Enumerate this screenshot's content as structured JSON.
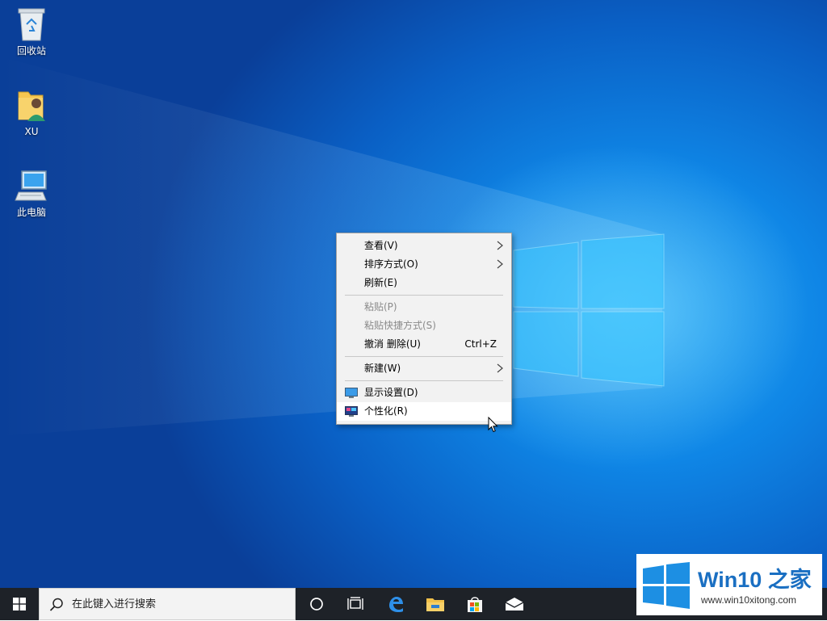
{
  "desktop": {
    "icons": [
      {
        "label": "回收站",
        "icon": "recycle-bin-icon"
      },
      {
        "label": "XU",
        "icon": "user-folder-icon"
      },
      {
        "label": "此电脑",
        "icon": "this-pc-icon"
      }
    ]
  },
  "context_menu": {
    "items": [
      {
        "label": "查看(V)",
        "submenu": true
      },
      {
        "label": "排序方式(O)",
        "submenu": true
      },
      {
        "label": "刷新(E)"
      },
      {
        "label": "粘贴(P)",
        "disabled": true
      },
      {
        "label": "粘贴快捷方式(S)",
        "disabled": true
      },
      {
        "label": "撤消 删除(U)",
        "shortcut": "Ctrl+Z"
      },
      {
        "label": "新建(W)",
        "submenu": true
      },
      {
        "label": "显示设置(D)",
        "icon": "display-settings-icon"
      },
      {
        "label": "个性化(R)",
        "icon": "personalize-icon",
        "hovered": true
      }
    ]
  },
  "taskbar": {
    "search_placeholder": "在此键入进行搜索",
    "buttons": [
      "start-icon",
      "cortana-icon",
      "task-view-icon",
      "edge-icon",
      "file-explorer-icon",
      "store-icon",
      "mail-icon"
    ]
  },
  "watermark": {
    "title": "Win10 之家",
    "url": "www.win10xitong.com"
  },
  "colors": {
    "menu_bg": "#f2f2f2",
    "taskbar_bg": "#1e2228",
    "watermark_blue": "#1a6fc2"
  }
}
